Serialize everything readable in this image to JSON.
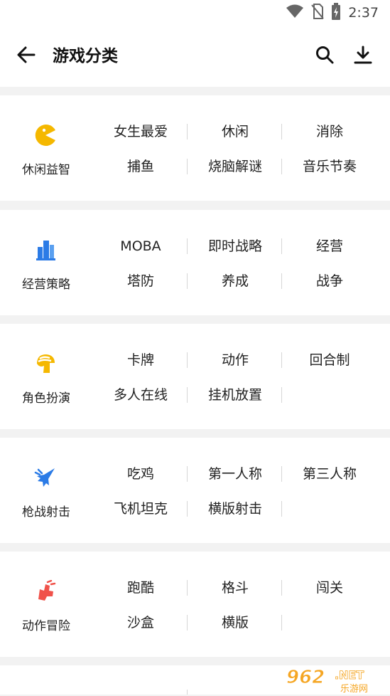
{
  "status_bar": {
    "time": "2:37",
    "icons": [
      "wifi-icon",
      "no-sim-icon",
      "battery-charging-icon"
    ]
  },
  "header": {
    "title": "游戏分类",
    "back_icon": "arrow-left-icon",
    "search_icon": "search-icon",
    "download_icon": "download-icon"
  },
  "categories": [
    {
      "label": "休闲益智",
      "icon": "pacman-icon",
      "color": "#f5b800",
      "tags": [
        "女生最爱",
        "休闲",
        "消除",
        "捕鱼",
        "烧脑解谜",
        "音乐节奏"
      ]
    },
    {
      "label": "经营策略",
      "icon": "buildings-icon",
      "color": "#2b7be6",
      "tags": [
        "MOBA",
        "即时战略",
        "经营",
        "塔防",
        "养成",
        "战争"
      ]
    },
    {
      "label": "角色扮演",
      "icon": "helmet-icon",
      "color": "#f5b800",
      "tags": [
        "卡牌",
        "动作",
        "回合制",
        "多人在线",
        "挂机放置",
        ""
      ]
    },
    {
      "label": "枪战射击",
      "icon": "jet-icon",
      "color": "#2b7be6",
      "tags": [
        "吃鸡",
        "第一人称",
        "第三人称",
        "飞机坦克",
        "横版射击",
        ""
      ]
    },
    {
      "label": "动作冒险",
      "icon": "fist-icon",
      "color": "#f0524a",
      "tags": [
        "跑酷",
        "格斗",
        "闯关",
        "沙盒",
        "横版",
        ""
      ]
    }
  ],
  "watermark": {
    "logo": "962",
    "suffix": ".NET",
    "sub": "乐游网"
  },
  "colors": {
    "accent_yellow": "#f5b800",
    "accent_blue": "#2b7be6",
    "accent_red": "#f0524a",
    "background": "#f2f2f2"
  }
}
